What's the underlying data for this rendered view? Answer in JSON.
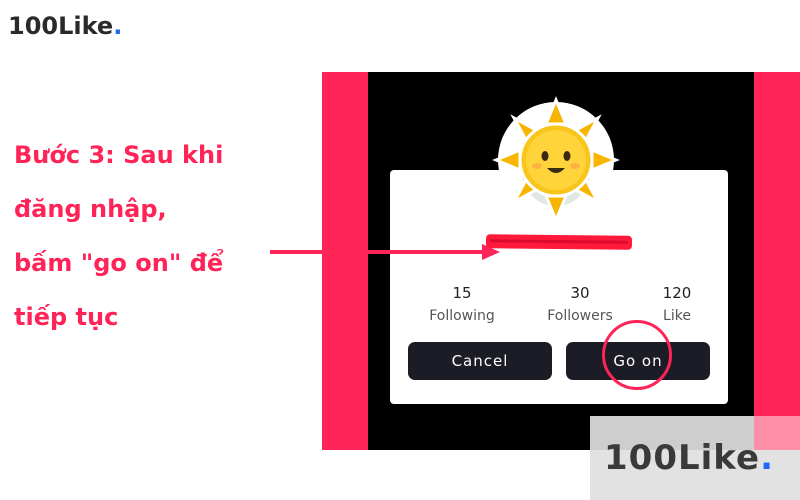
{
  "header": {
    "brand_main": "100Like",
    "brand_dot": "."
  },
  "instruction": {
    "lines": [
      "Bước 3: Sau khi",
      "đăng nhập,",
      "bấm \"go on\" để",
      "tiếp tục"
    ],
    "color": "#ff2458"
  },
  "dialog": {
    "stats": [
      {
        "value": "15",
        "label": "Following"
      },
      {
        "value": "30",
        "label": "Followers"
      },
      {
        "value": "120",
        "label": "Like"
      }
    ],
    "cancel_label": "Cancel",
    "go_on_label": "Go on",
    "avatar_icon": "sun-emoji-icon",
    "username_redacted": true
  },
  "watermark": {
    "main": "100Like",
    "dot": "."
  },
  "colors": {
    "accent": "#ff2458",
    "button_bg": "#1b1c25",
    "brand_dot": "#1e66f5"
  }
}
